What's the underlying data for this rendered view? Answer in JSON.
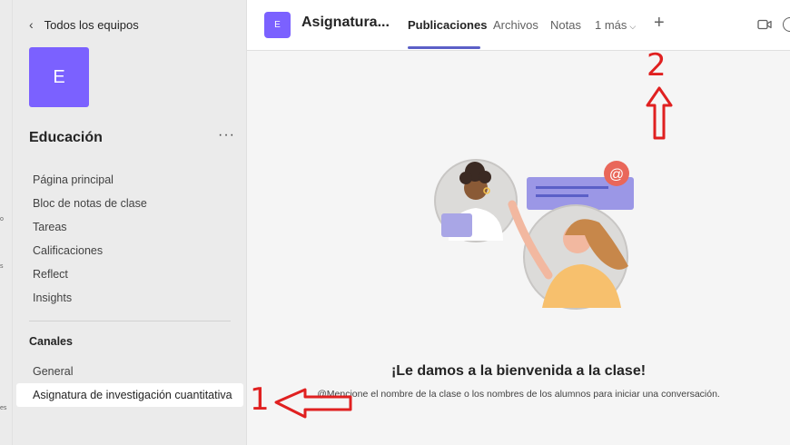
{
  "rail": {
    "fragments": [
      "o",
      "s",
      "es"
    ]
  },
  "sidebar": {
    "back_label": "Todos los equipos",
    "team_initial": "E",
    "team_name": "Educación",
    "more_label": "···",
    "nav_items": [
      {
        "label": "Página principal"
      },
      {
        "label": "Bloc de notas de clase"
      },
      {
        "label": "Tareas"
      },
      {
        "label": "Calificaciones"
      },
      {
        "label": "Reflect"
      },
      {
        "label": "Insights"
      }
    ],
    "channels_heading": "Canales",
    "channels": [
      {
        "label": "General"
      },
      {
        "label": "Asignatura de investigación cuantitativa"
      }
    ]
  },
  "header": {
    "channel_initial": "E",
    "channel_title": "Asignatura...",
    "tabs": [
      {
        "label": "Publicaciones"
      },
      {
        "label": "Archivos"
      },
      {
        "label": "Notas"
      }
    ],
    "more_tabs_label": "1 más",
    "add_tab_label": "+"
  },
  "main": {
    "welcome_title": "¡Le damos a la bienvenida a la clase!",
    "welcome_subtitle": "@Mencione el nombre de la clase o los nombres de los alumnos para iniciar una conversación."
  },
  "annotations": {
    "one": "1",
    "two": "2"
  },
  "colors": {
    "accent": "#5b5fc7",
    "avatar": "#7b61ff",
    "annotation": "#e02020"
  }
}
